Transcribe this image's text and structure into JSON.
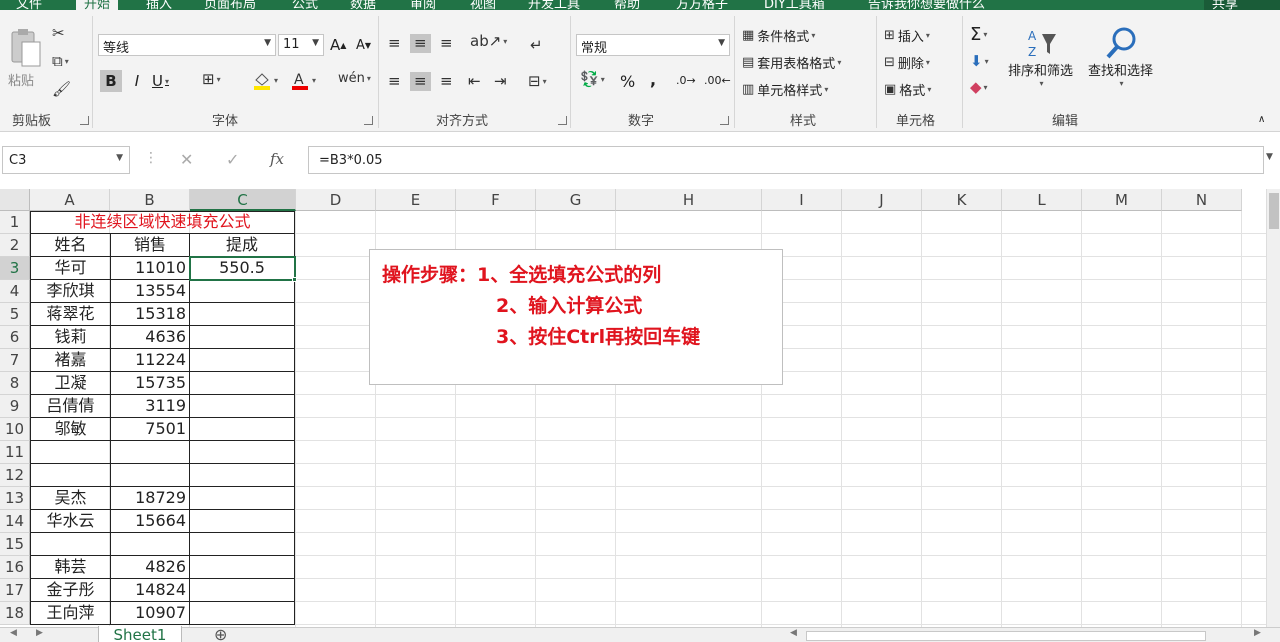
{
  "tabs": [
    "文件",
    "开始",
    "插入",
    "页面布局",
    "公式",
    "数据",
    "审阅",
    "视图",
    "开发工具",
    "帮助",
    "方方格子",
    "DIY工具箱",
    "告诉我你想要做什么"
  ],
  "share_label": "共享",
  "ribbon": {
    "clipboard": {
      "paste": "粘贴",
      "label": "剪贴板"
    },
    "font": {
      "name": "等线",
      "size": "11",
      "bold": "B",
      "italic": "I",
      "underline": "U",
      "label": "字体",
      "grow": "A",
      "shrink": "A"
    },
    "align": {
      "label": "对齐方式"
    },
    "number": {
      "format": "常规",
      "label": "数字",
      "percent": "%",
      "comma": ","
    },
    "styles": {
      "conditional": "条件格式",
      "table": "套用表格格式",
      "cell": "单元格样式",
      "label": "样式"
    },
    "cells": {
      "insert": "插入",
      "delete": "删除",
      "format": "格式",
      "label": "单元格"
    },
    "edit": {
      "sum": "Σ",
      "sort": "排序和筛选",
      "find": "查找和选择",
      "label": "编辑"
    }
  },
  "formula_bar": {
    "name_box": "C3",
    "fx": "fx",
    "formula": "=B3*0.05"
  },
  "columns": [
    "A",
    "B",
    "C",
    "D",
    "E",
    "F",
    "G",
    "H",
    "I",
    "J",
    "K",
    "L",
    "M",
    "N"
  ],
  "rows": [
    "1",
    "2",
    "3",
    "4",
    "5",
    "6",
    "7",
    "8",
    "9",
    "10",
    "11",
    "12",
    "13",
    "14",
    "15",
    "16",
    "17",
    "18"
  ],
  "sheet": {
    "title": "非连续区域快速填充公式",
    "headers": [
      "姓名",
      "销售",
      "提成"
    ],
    "data": [
      {
        "name": "华可",
        "sales": "11010",
        "commission": "550.5"
      },
      {
        "name": "李欣琪",
        "sales": "13554",
        "commission": ""
      },
      {
        "name": "蒋翠花",
        "sales": "15318",
        "commission": ""
      },
      {
        "name": "钱莉",
        "sales": "4636",
        "commission": ""
      },
      {
        "name": "褚嘉",
        "sales": "11224",
        "commission": ""
      },
      {
        "name": "卫凝",
        "sales": "15735",
        "commission": ""
      },
      {
        "name": "吕倩倩",
        "sales": "3119",
        "commission": ""
      },
      {
        "name": "邬敏",
        "sales": "7501",
        "commission": ""
      },
      {
        "name": "",
        "sales": "",
        "commission": ""
      },
      {
        "name": "",
        "sales": "",
        "commission": ""
      },
      {
        "name": "吴杰",
        "sales": "18729",
        "commission": ""
      },
      {
        "name": "华水云",
        "sales": "15664",
        "commission": ""
      },
      {
        "name": "",
        "sales": "",
        "commission": ""
      },
      {
        "name": "韩芸",
        "sales": "4826",
        "commission": ""
      },
      {
        "name": "金子彤",
        "sales": "14824",
        "commission": ""
      },
      {
        "name": "王向萍",
        "sales": "10907",
        "commission": ""
      }
    ]
  },
  "note": {
    "line1": "操作步骤：1、全选填充公式的列",
    "line2": "2、输入计算公式",
    "line3": "3、按住Ctrl再按回车键"
  },
  "sheet_tab": "Sheet1",
  "colors": {
    "excel_green": "#217346",
    "note_red": "#e0141e",
    "title_red": "#e0141e"
  }
}
